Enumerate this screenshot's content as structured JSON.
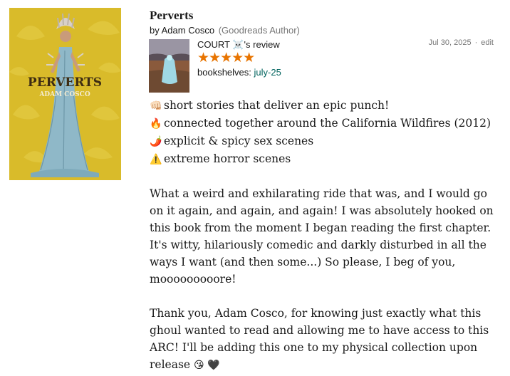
{
  "book": {
    "title": "Perverts",
    "by": "by",
    "author": "Adam Cosco",
    "author_badge": "(Goodreads Author)",
    "cover": {
      "title": "PERVERTS",
      "author": "ADAM COSCO",
      "bg_color": "#d9bb2a"
    }
  },
  "review": {
    "reviewer_line": "COURT ☠️'s review",
    "rating": 5,
    "stars": "★★★★★",
    "star_color": "#e87400",
    "shelves_label": "bookshelves:",
    "shelf": "july-25",
    "date": "Jul 30, 2025",
    "separator": "·",
    "edit": "edit",
    "highlights": [
      {
        "icon": "fist-icon",
        "emoji": "👊🏻",
        "text": "short stories that deliver an epic punch!"
      },
      {
        "icon": "fire-icon",
        "emoji": "🔥",
        "text": "connected together around the California Wildfires (2012)"
      },
      {
        "icon": "chili-icon",
        "emoji": "🌶️",
        "text": "explicit & spicy sex scenes"
      },
      {
        "icon": "warning-icon",
        "emoji": "⚠️",
        "text": "extreme horror scenes"
      }
    ],
    "paragraph1": "What a weird and exhilarating ride that was, and I would go on it again, and again, and again! I was absolutely hooked on this book from the moment I began reading the first chapter. It's witty, hilariously comedic and darkly disturbed in all the ways I want (and then some...) So please, I beg of you, mooooooooore!",
    "paragraph2": "Thank you, Adam Cosco, for knowing just exactly what this ghoul wanted to read and allowing me to have access to this ARC! I'll be adding this one to my physical collection upon release",
    "paragraph2_emojis": "😘 🖤"
  },
  "colors": {
    "link_teal": "#00635d",
    "muted": "#767676"
  }
}
